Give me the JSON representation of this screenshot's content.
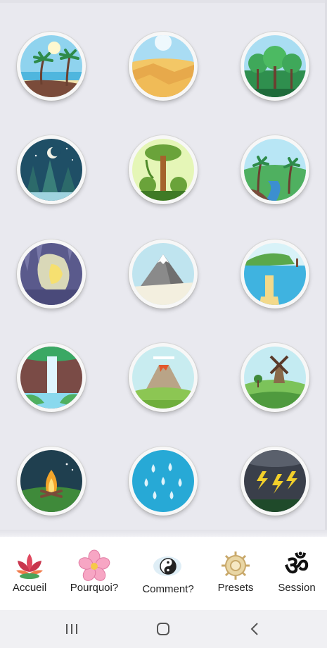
{
  "scenes": [
    {
      "icon": "beach-icon"
    },
    {
      "icon": "desert-icon"
    },
    {
      "icon": "forest-icon"
    },
    {
      "icon": "night-forest-icon"
    },
    {
      "icon": "jungle-tree-icon"
    },
    {
      "icon": "tropical-valley-icon"
    },
    {
      "icon": "cave-icon"
    },
    {
      "icon": "mountain-icon"
    },
    {
      "icon": "lake-pier-icon"
    },
    {
      "icon": "waterfall-icon"
    },
    {
      "icon": "volcano-icon"
    },
    {
      "icon": "windmill-icon"
    },
    {
      "icon": "campfire-icon"
    },
    {
      "icon": "rain-icon"
    },
    {
      "icon": "storm-icon"
    }
  ],
  "tabs": [
    {
      "label": "Accueil",
      "icon": "lotus-icon"
    },
    {
      "label": "Pourquoi?",
      "icon": "pink-flower-icon"
    },
    {
      "label": "Comment?",
      "icon": "yin-yang-icon"
    },
    {
      "label": "Presets",
      "icon": "dharma-wheel-icon"
    },
    {
      "label": "Session",
      "icon": "om-icon"
    }
  ],
  "system_nav": {
    "recent": "recent-apps-icon",
    "home": "home-icon",
    "back": "back-icon"
  }
}
